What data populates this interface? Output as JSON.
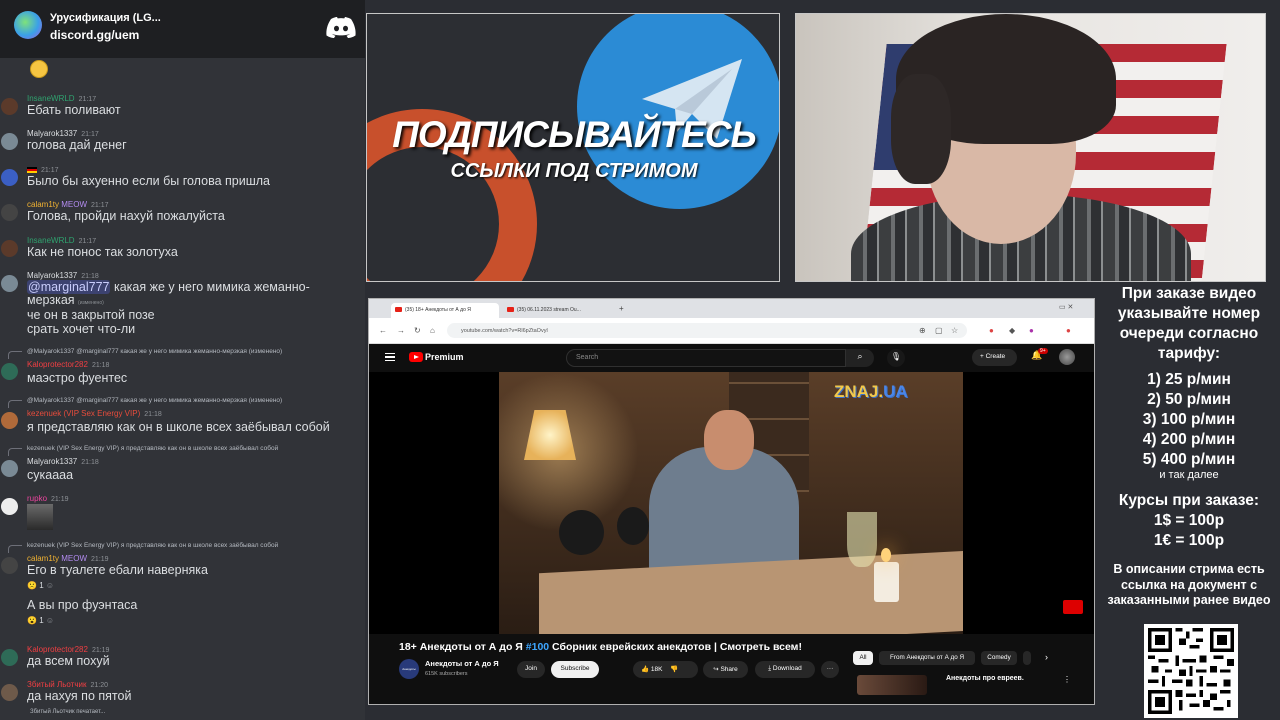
{
  "discord": {
    "server_title": "Урусификация (LG...",
    "invite": "discord.gg/uem",
    "messages": [
      {
        "user": "InsaneWRLD",
        "color": "#2fa36f",
        "time": "21:17",
        "text": "Ебать поливают"
      },
      {
        "user": "Malyarok1337",
        "color": "#dbdee1",
        "time": "21:17",
        "text": "голова дай денег"
      },
      {
        "user": "",
        "color": "#dbdee1",
        "time": "21:17",
        "text": "Было бы ахуенно если бы голова пришла"
      },
      {
        "user": "calam1ty",
        "color": "#f0b232",
        "badge": "MEOW",
        "time": "21:17",
        "text": "Голова, пройди нахуй пожалуйста"
      },
      {
        "user": "InsaneWRLD",
        "color": "#2fa36f",
        "time": "21:17",
        "text": "Как не понос так золотуха"
      },
      {
        "user": "Malyarok1337",
        "color": "#dbdee1",
        "time": "21:18",
        "mention": "@marginal777",
        "text": " какая же у него мимика жеманно-",
        "text2": "мерзкая",
        "edited": "(изменено)",
        "line3": "че он в закрытой позе",
        "line4": "срать хочет что-ли"
      },
      {
        "reply": "@Malyarok1337 @marginal777 какая же у него мимика жеманно-мерзкая (изменено)",
        "user": "Kaloprotector282",
        "color": "#f23f43",
        "time": "21:18",
        "text": "маэстро фуентес"
      },
      {
        "reply": "@Malyarok1337 @marginal777 какая же у него мимика жеманно-мерзкая (изменено)",
        "user": "kezenuek (VIP Sex Energy VIP)",
        "color": "#e74c3c",
        "time": "21:18",
        "text": "я представляю как он в школе всех заёбывал собой"
      },
      {
        "reply": "kezenuek (VIP Sex Energy VIP) я представляю как он в школе всех заёбывал собой",
        "user": "Malyarok1337",
        "color": "#dbdee1",
        "time": "21:18",
        "text": "сукаааа"
      },
      {
        "user": "rupko",
        "color": "#eb459e",
        "time": "21:19",
        "text": ""
      },
      {
        "reply": "kezenuek (VIP Sex Energy VIP) я представляю как он в школе всех заёбывал собой",
        "user": "calam1ty",
        "color": "#f0b232",
        "badge": "MEOW",
        "time": "21:19",
        "text": "Его в туалете ебали наверняка",
        "react": "1",
        "text_b": "А вы про фуэнтаса",
        "react_b": "1"
      },
      {
        "user": "Kaloprotector282",
        "color": "#f23f43",
        "time": "21:19",
        "text": "да всем похуй"
      },
      {
        "user": "Збитый Льотчик",
        "color": "#f23f43",
        "time": "21:20",
        "text": "да нахуя по пятой"
      }
    ],
    "typing": "Збитый Льотчик печатает..."
  },
  "promo": {
    "line1": "ПОДПИСЫВАЙТЕСЬ",
    "line2": "ССЫЛКИ ПОД СТРИМОМ"
  },
  "browser": {
    "tabs": [
      "(35) 18+ Анекдоты от А до Я",
      "(35) 06.11.2023 stream Ou..."
    ],
    "new_tab": "+",
    "url": "youtube.com/watch?v=Rl6pZtaOvyl",
    "yt": {
      "premium": "Premium",
      "search_placeholder": "Search",
      "create": "+ Create",
      "notif_count": "9+",
      "video_title": "18+ Анекдоты от А до Я #100 Сборник еврейских анекдотов | Смотреть всем!",
      "title_prefix": "18+ Анекдоты от А до Я ",
      "title_tag": "#100",
      "title_suffix": " Сборник еврейских анекдотов | Смотреть всем!",
      "channel": "Анекдоты от А до Я",
      "subscribers": "615K subscribers",
      "join": "Join",
      "subscribe": "Subscribe",
      "likes": "18K",
      "share": "Share",
      "download": "Download",
      "more": "···",
      "filters": [
        "All",
        "From Анекдоты от А до Я",
        "Comedy"
      ],
      "rec_title": "Анекдоты про евреев.",
      "watermark_a": "ZNAJ.",
      "watermark_b": "UA",
      "channel_logo": "Анекдоты"
    }
  },
  "info": {
    "order_text": "При заказе видео указывайте номер очереди согласно тарифу:",
    "tariffs": [
      "1) 25 р/мин",
      "2) 50 р/мин",
      "3) 100 р/мин",
      "4) 200 р/мин",
      "5) 400 р/мин"
    ],
    "etc": "и так далее",
    "rates_title": "Курсы при заказе:",
    "rates": [
      "1$ = 100р",
      "1€ = 100р"
    ],
    "note": "В описании стрима есть ссылка на документ с заказанными ранее видео"
  }
}
